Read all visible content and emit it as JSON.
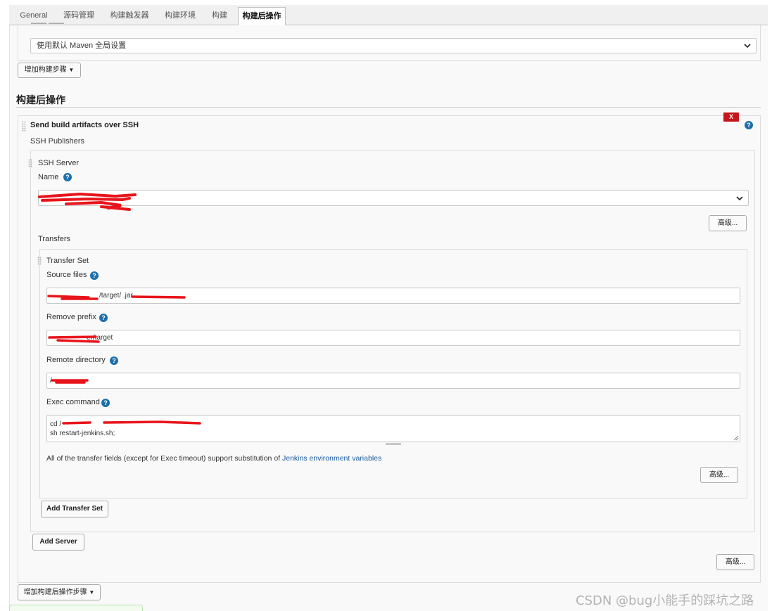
{
  "tabs": [
    {
      "label": "General",
      "active": false
    },
    {
      "label": "源码管理",
      "active": false
    },
    {
      "label": "构建触发器",
      "active": false
    },
    {
      "label": "构建环境",
      "active": false
    },
    {
      "label": "构建",
      "active": false
    },
    {
      "label": "构建后操作",
      "active": true
    }
  ],
  "build_step": {
    "settings_select": "使用默认 Maven 全局设置",
    "add_build_step_label": "增加构建步骤"
  },
  "post_build": {
    "section_title": "构建后操作",
    "delete_label": "X",
    "plugin_title": "Send build artifacts over SSH",
    "publishers_label": "SSH Publishers",
    "ssh_server": {
      "title": "SSH Server",
      "name_label": "Name",
      "advanced_label": "高级...",
      "transfers_label": "Transfers"
    },
    "transfer_set": {
      "title": "Transfer Set",
      "source_files_label": "Source files",
      "source_files_value": "/target/    .jar",
      "remove_prefix_label": "Remove prefix",
      "remove_prefix_value": "    er/target",
      "remote_directory_label": "Remote directory",
      "remote_directory_value": "/",
      "exec_command_label": "Exec command",
      "exec_line1": "cd /",
      "exec_line2": "sh restart-jenkins.sh;",
      "note_text": "All of the transfer fields (except for Exec timeout) support substitution of ",
      "note_link": "Jenkins environment variables",
      "advanced_label": "高级..."
    },
    "add_transfer_set_label": "Add Transfer Set",
    "add_server_label": "Add Server",
    "advanced_label": "高级...",
    "add_post_build_step_label": "增加构建后操作步骤"
  },
  "watermark": "CSDN @bug小能手的踩坑之路",
  "colors": {
    "help_icon": "#1c6faa",
    "delete_button": "#c4161c",
    "link": "#1a5aa0",
    "redaction": "#e8141b"
  },
  "icons": {
    "help": "help-icon",
    "dropdown": "chevron-down-icon",
    "drag": "drag-handle-icon",
    "caret": "caret-down-icon"
  }
}
